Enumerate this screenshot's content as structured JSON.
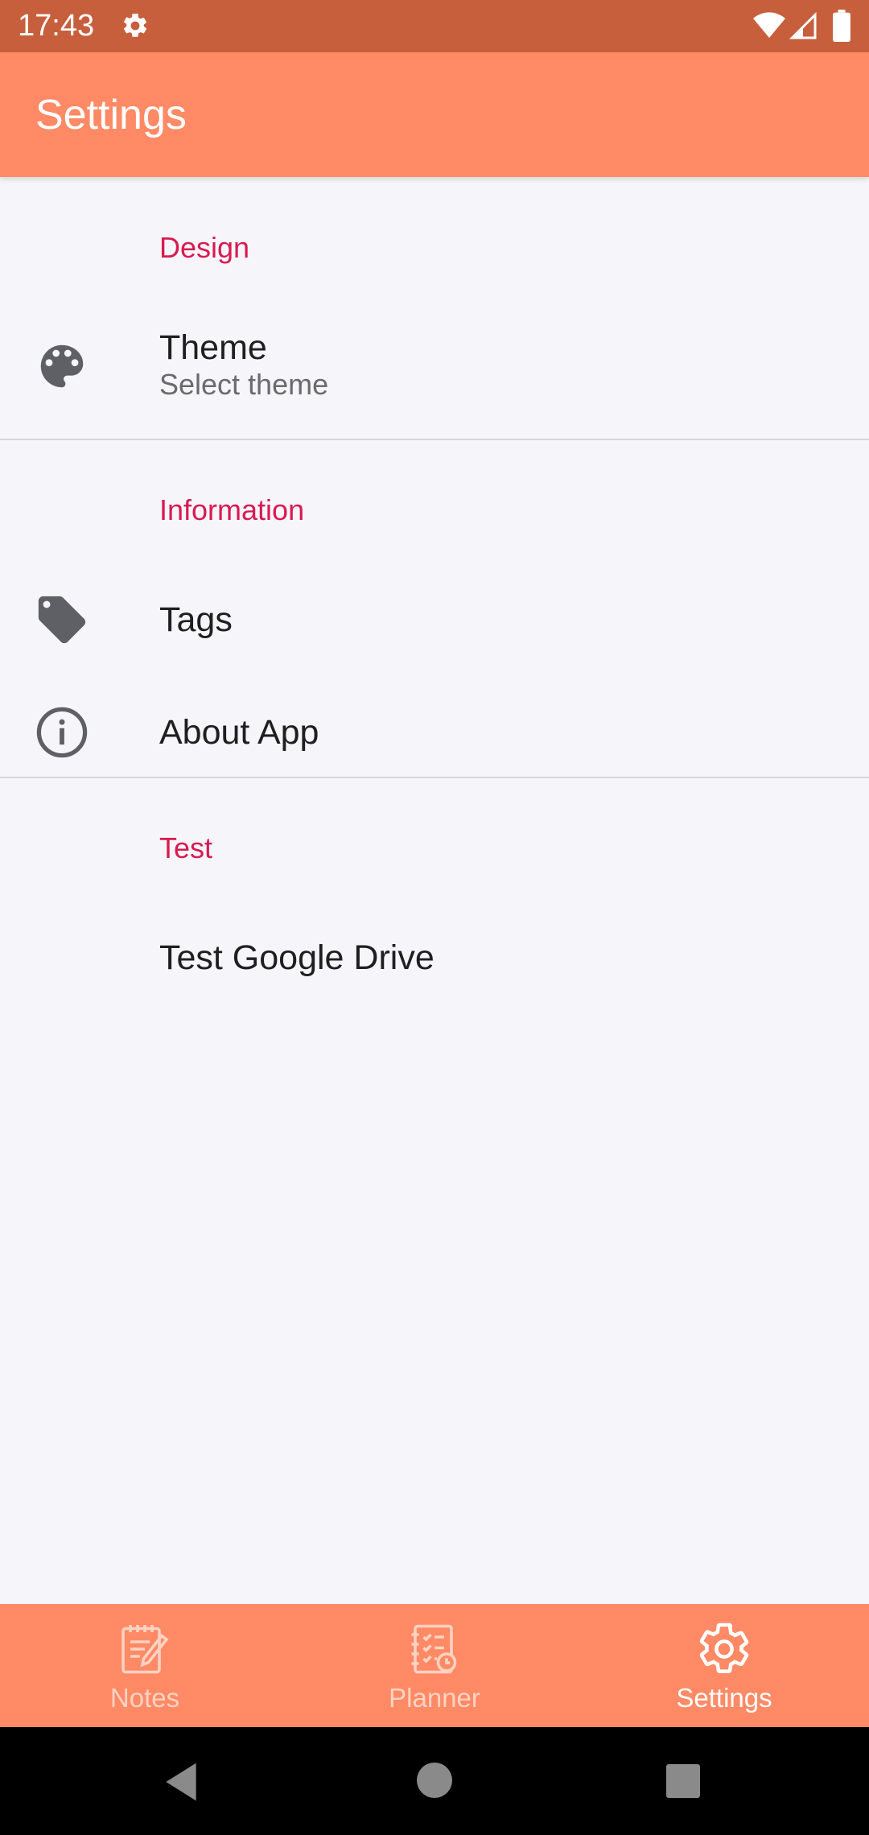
{
  "status_bar": {
    "time": "17:43",
    "icons": [
      "gear-icon",
      "wifi-icon",
      "signal-icon",
      "battery-icon"
    ]
  },
  "app_bar": {
    "title": "Settings",
    "color": "#ff8a65"
  },
  "sections": [
    {
      "header": "Design",
      "items": [
        {
          "title": "Theme",
          "summary": "Select theme",
          "icon": "palette-icon"
        }
      ]
    },
    {
      "header": "Information",
      "items": [
        {
          "title": "Tags",
          "icon": "tag-icon"
        },
        {
          "title": "About App",
          "icon": "info-icon"
        }
      ]
    },
    {
      "header": "Test",
      "items": [
        {
          "title": "Test Google Drive"
        }
      ]
    }
  ],
  "bottom_nav": {
    "items": [
      {
        "label": "Notes",
        "icon": "notes-icon",
        "active": false
      },
      {
        "label": "Planner",
        "icon": "planner-icon",
        "active": false
      },
      {
        "label": "Settings",
        "icon": "settings-icon",
        "active": true
      }
    ]
  },
  "colors": {
    "accent": "#d81b50",
    "status_bar": "#c75f3c",
    "background": "#f5f5fa"
  }
}
